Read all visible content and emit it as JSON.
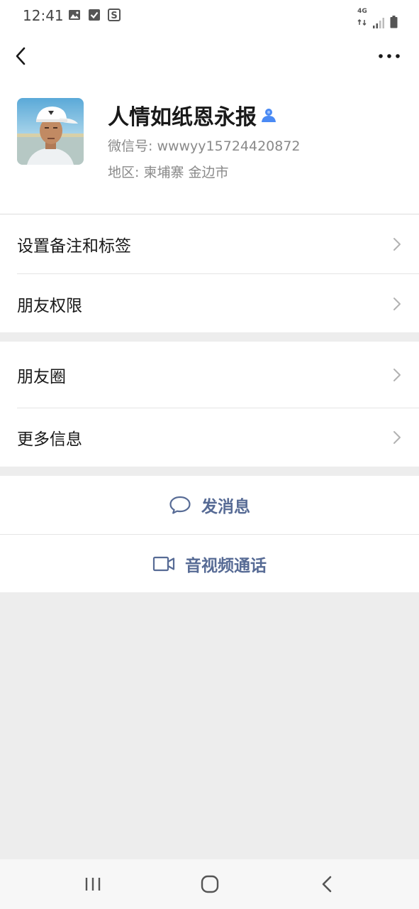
{
  "status_bar": {
    "time": "12:41",
    "network_label": "4G",
    "left_icons": [
      "image-icon",
      "checkbox-icon",
      "s-app-icon"
    ],
    "right_icons": [
      "network-arrows-icon",
      "signal-icon",
      "battery-icon"
    ]
  },
  "header": {
    "back_icon": "chevron-left-icon",
    "more_icon": "more-dots-icon"
  },
  "profile": {
    "name": "人情如纸恩永报",
    "wechat_id": "微信号: wwwyy15724420872",
    "region": "地区: 柬埔寨  金边市"
  },
  "menu_section_1": {
    "items": [
      {
        "label": "设置备注和标签"
      },
      {
        "label": "朋友权限"
      }
    ]
  },
  "menu_section_2": {
    "items": [
      {
        "label": "朋友圈"
      },
      {
        "label": "更多信息"
      }
    ]
  },
  "actions": {
    "send_message": "发消息",
    "video_call": "音视频通话"
  },
  "colors": {
    "link": "#576b95",
    "background": "#ededed",
    "panel": "#ffffff",
    "contact_icon": "#4a8af4"
  }
}
